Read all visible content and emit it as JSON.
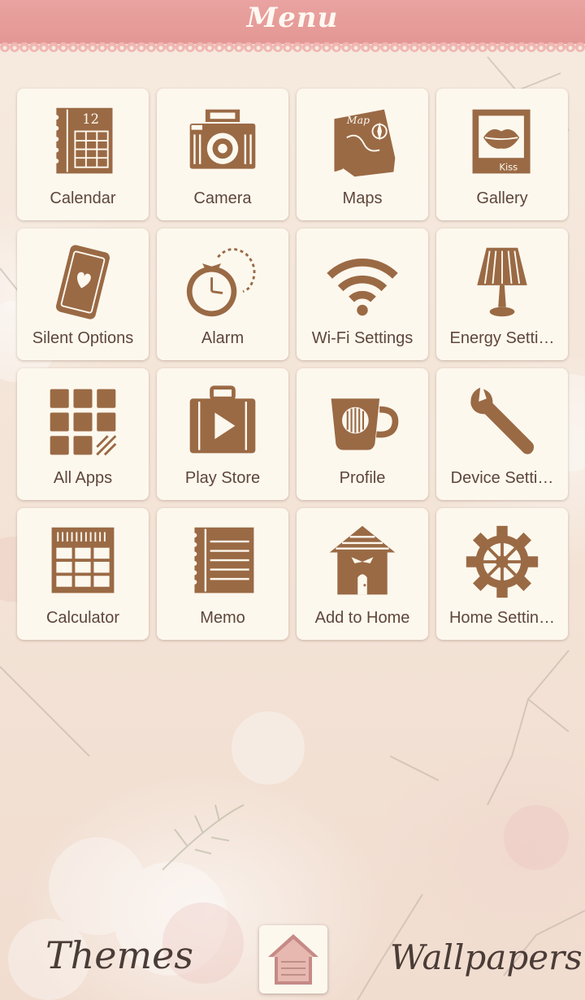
{
  "header": {
    "title": "Menu"
  },
  "theme": {
    "accent": "#e49895",
    "icon_brown": "#9a6a45",
    "tile_bg": "#fdf8ee",
    "text": "#5e463a"
  },
  "apps": [
    {
      "label": "Calendar",
      "icon": "calendar-icon",
      "badge": "12"
    },
    {
      "label": "Camera",
      "icon": "camera-icon"
    },
    {
      "label": "Maps",
      "icon": "map-icon",
      "badge": "Map"
    },
    {
      "label": "Gallery",
      "icon": "gallery-lips-icon",
      "badge": "Kiss"
    },
    {
      "label": "Silent Options",
      "icon": "phone-heart-icon"
    },
    {
      "label": "Alarm",
      "icon": "alarm-clock-icon"
    },
    {
      "label": "Wi-Fi Settings",
      "icon": "wifi-icon"
    },
    {
      "label": "Energy Setti…",
      "icon": "lamp-icon"
    },
    {
      "label": "All Apps",
      "icon": "grid-icon"
    },
    {
      "label": "Play Store",
      "icon": "suitcase-play-icon"
    },
    {
      "label": "Profile",
      "icon": "mug-icon"
    },
    {
      "label": "Device Setti…",
      "icon": "wrench-icon"
    },
    {
      "label": "Calculator",
      "icon": "calculator-icon"
    },
    {
      "label": "Memo",
      "icon": "notebook-icon"
    },
    {
      "label": "Add to Home",
      "icon": "house-icon"
    },
    {
      "label": "Home Settin…",
      "icon": "gear-icon"
    }
  ],
  "bottom": {
    "left_label": "Themes",
    "right_label": "Wallpapers",
    "center": "home-theme-icon"
  }
}
